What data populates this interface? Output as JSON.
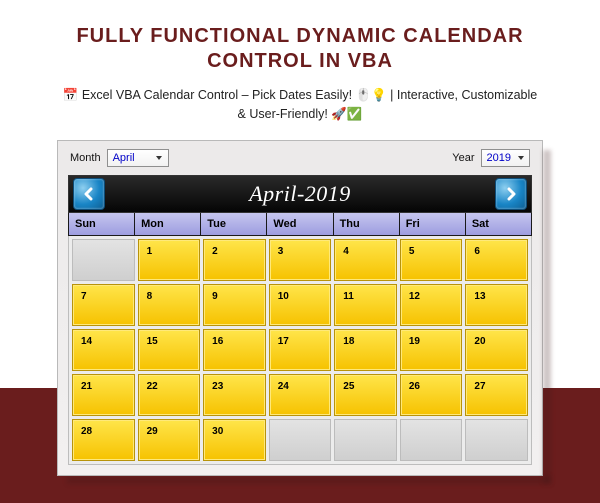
{
  "page": {
    "title": "FULLY FUNCTIONAL DYNAMIC CALENDAR CONTROL IN VBA",
    "subtitle": "📅 Excel VBA Calendar Control – Pick Dates Easily! 🖱️💡 | Interactive, Customizable & User-Friendly! 🚀✅"
  },
  "controls": {
    "month_label": "Month",
    "month_value": "April",
    "year_label": "Year",
    "year_value": "2019"
  },
  "header": {
    "label": "April-2019"
  },
  "dow": [
    "Sun",
    "Mon",
    "Tue",
    "Wed",
    "Thu",
    "Fri",
    "Sat"
  ],
  "cells": [
    {
      "day": "",
      "in": false
    },
    {
      "day": "1",
      "in": true
    },
    {
      "day": "2",
      "in": true
    },
    {
      "day": "3",
      "in": true
    },
    {
      "day": "4",
      "in": true
    },
    {
      "day": "5",
      "in": true
    },
    {
      "day": "6",
      "in": true
    },
    {
      "day": "7",
      "in": true
    },
    {
      "day": "8",
      "in": true
    },
    {
      "day": "9",
      "in": true
    },
    {
      "day": "10",
      "in": true
    },
    {
      "day": "11",
      "in": true
    },
    {
      "day": "12",
      "in": true
    },
    {
      "day": "13",
      "in": true
    },
    {
      "day": "14",
      "in": true
    },
    {
      "day": "15",
      "in": true
    },
    {
      "day": "16",
      "in": true
    },
    {
      "day": "17",
      "in": true
    },
    {
      "day": "18",
      "in": true
    },
    {
      "day": "19",
      "in": true
    },
    {
      "day": "20",
      "in": true
    },
    {
      "day": "21",
      "in": true
    },
    {
      "day": "22",
      "in": true
    },
    {
      "day": "23",
      "in": true
    },
    {
      "day": "24",
      "in": true
    },
    {
      "day": "25",
      "in": true
    },
    {
      "day": "26",
      "in": true
    },
    {
      "day": "27",
      "in": true
    },
    {
      "day": "28",
      "in": true
    },
    {
      "day": "29",
      "in": true
    },
    {
      "day": "30",
      "in": true
    },
    {
      "day": "",
      "in": false
    },
    {
      "day": "",
      "in": false
    },
    {
      "day": "",
      "in": false
    },
    {
      "day": "",
      "in": false
    }
  ]
}
